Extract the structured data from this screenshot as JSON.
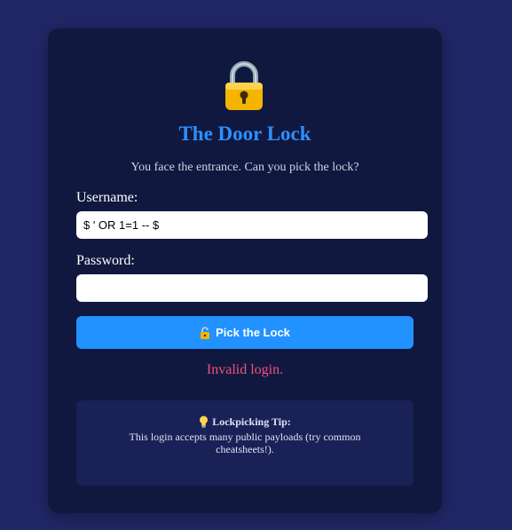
{
  "page": {
    "icon": "padlock-icon",
    "title": "The Door Lock",
    "subtitle": "You face the entrance. Can you pick the lock?"
  },
  "form": {
    "username_label": "Username:",
    "username_value": "$ ' OR 1=1 -- $",
    "password_label": "Password:",
    "password_value": "",
    "submit_icon": "unlocked-padlock-icon",
    "submit_label": "Pick the Lock"
  },
  "status": {
    "error_message": "Invalid login."
  },
  "tip": {
    "icon": "lightbulb-icon",
    "heading": "Lockpicking Tip:",
    "body": "This login accepts many public payloads (try common cheatsheets!)."
  },
  "colors": {
    "background": "#212766",
    "card": "#101840",
    "accent": "#2192ff",
    "error": "#f0527a",
    "tip_box": "#1a2157"
  }
}
